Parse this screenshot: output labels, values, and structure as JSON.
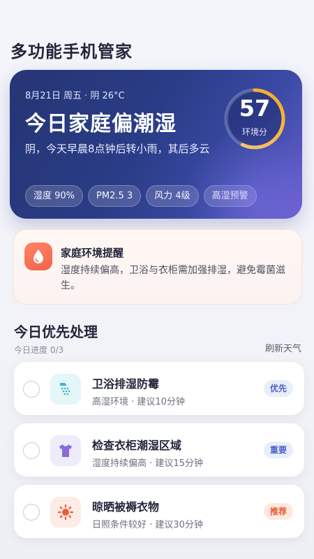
{
  "app": {
    "title": "多功能手机管家"
  },
  "hero": {
    "date": "8月21日 周五 · 阴 26°C",
    "title": "今日家庭偏潮湿",
    "desc": "阴，今天早晨8点钟后转小雨，其后多云",
    "score": {
      "value": "57",
      "label": "环境分",
      "fraction": 0.57
    },
    "chips": [
      "湿度 90%",
      "PM2.5 3",
      "风力 4级",
      "高湿预警"
    ]
  },
  "alert": {
    "title": "家庭环境提醒",
    "text": "湿度持续偏高，卫浴与衣柜需加强排湿，避免霉菌滋生。",
    "icon": "water-drop-icon"
  },
  "tasks_section": {
    "title": "今日优先处理",
    "progress": "今日进度 0/3",
    "refresh": "刷新天气",
    "items": [
      {
        "name": "卫浴排湿防霉",
        "meta": "高湿环境 · 建议10分钟",
        "badge": "优先",
        "icon": "shower-icon",
        "icon_bg": "#e3f6f8",
        "icon_color": "#3fb8c8",
        "badge_bg": "#e9eefb",
        "badge_color": "#4b63c6"
      },
      {
        "name": "检查衣柜潮湿区域",
        "meta": "湿度持续偏高 · 建议15分钟",
        "badge": "重要",
        "icon": "tshirt-icon",
        "icon_bg": "#eeebfb",
        "icon_color": "#8a6ad9",
        "badge_bg": "#e9eefb",
        "badge_color": "#4b63c6"
      },
      {
        "name": "晾晒被褥衣物",
        "meta": "日照条件较好 · 建议30分钟",
        "badge": "推荐",
        "icon": "sun-icon",
        "icon_bg": "#fdece6",
        "icon_color": "#ec5c3a",
        "badge_bg": "#fde9e2",
        "badge_color": "#e2582f"
      }
    ]
  }
}
